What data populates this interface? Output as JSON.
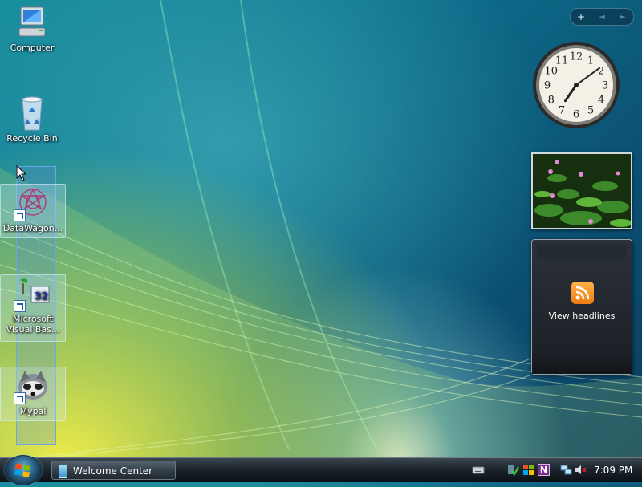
{
  "desktop": {
    "icons": [
      {
        "label": "Computer"
      },
      {
        "label": "Recycle Bin"
      },
      {
        "label": "DataWagon..."
      },
      {
        "label": "Microsoft Visual Bas..."
      },
      {
        "label": "Mypal"
      }
    ]
  },
  "sidebar": {
    "toolbar": {
      "add": "+",
      "prev": "◄",
      "next": "►"
    },
    "clock": {
      "hour": 7,
      "minute": 9
    },
    "feed": {
      "label": "View headlines"
    }
  },
  "taskbar": {
    "task_button": {
      "label": "Welcome Center"
    },
    "onenote_letter": "N",
    "time": "7:09 PM"
  },
  "colors": {
    "rss": "#f08a1c",
    "taskbar": "#1d252c"
  }
}
